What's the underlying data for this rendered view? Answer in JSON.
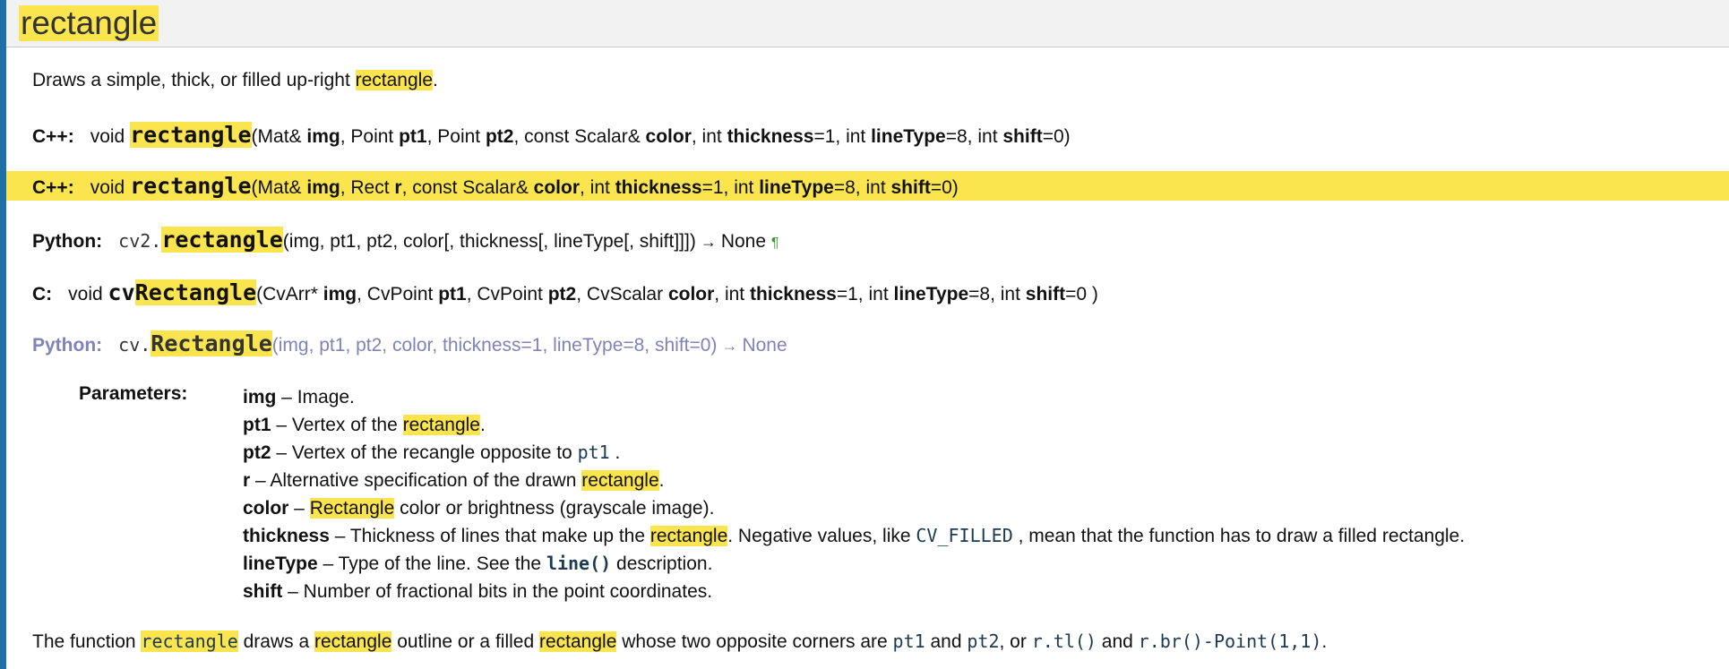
{
  "header": {
    "title": "rectangle"
  },
  "description": {
    "pre": "Draws a simple, thick, or filled up-right ",
    "hl": "rectangle",
    "post": "."
  },
  "signatures": {
    "cpp1": {
      "label": "C++:",
      "ret": "void",
      "fname": "rectangle",
      "open": "(Mat& ",
      "img": "img",
      "s1": ", Point ",
      "pt1": "pt1",
      "s2": ", Point ",
      "pt2": "pt2",
      "s3": ", const Scalar& ",
      "color": "color",
      "s4": ", int ",
      "thickness": "thickness",
      "s5": "=1, int ",
      "lineType": "lineType",
      "s6": "=8, int ",
      "shift": "shift",
      "close": "=0)"
    },
    "cpp2": {
      "label": "C++:",
      "ret": "void",
      "fname": "rectangle",
      "open": "(Mat& ",
      "img": "img",
      "s1": ", Rect ",
      "r": "r",
      "s2": ", const Scalar& ",
      "color": "color",
      "s3": ", int ",
      "thickness": "thickness",
      "s4": "=1, int ",
      "lineType": "lineType",
      "s5": "=8, int ",
      "shift": "shift",
      "close": "=0)"
    },
    "py2": {
      "label": "Python:",
      "module": "cv2.",
      "fname": "rectangle",
      "args": "(img, pt1, pt2, color[, thickness[, lineType[, shift]]])",
      "arrow": " → ",
      "ret": "None",
      "para": "¶"
    },
    "c": {
      "label": "C:",
      "ret": "void",
      "prefix": "cv",
      "fname": "Rectangle",
      "open": "(CvArr* ",
      "img": "img",
      "s1": ", CvPoint ",
      "pt1": "pt1",
      "s2": ", CvPoint ",
      "pt2": "pt2",
      "s3": ", CvScalar ",
      "color": "color",
      "s4": ", int ",
      "thickness": "thickness",
      "s5": "=1, int ",
      "lineType": "lineType",
      "s6": "=8, int ",
      "shift": "shift",
      "close": "=0 )"
    },
    "py1": {
      "label": "Python:",
      "module": "cv.",
      "fname": "Rectangle",
      "args": "(img, pt1, pt2, color, thickness=1, lineType=8, shift=0)",
      "arrow": " → ",
      "ret": "None"
    }
  },
  "parameters": {
    "label": "Parameters:",
    "img": {
      "name": "img",
      "desc": " – Image."
    },
    "pt1": {
      "name": "pt1",
      "desc": " – Vertex of the ",
      "hl": "rectangle",
      "end": "."
    },
    "pt2": {
      "name": "pt2",
      "desc": " – Vertex of the recangle opposite to ",
      "code": "pt1",
      "end": " ."
    },
    "r": {
      "name": "r",
      "desc": " – Alternative specification of the drawn ",
      "hl": "rectangle",
      "end": "."
    },
    "color": {
      "name": "color",
      "dash": " – ",
      "hl": "Rectangle",
      "desc": " color or brightness (grayscale image)."
    },
    "thickness": {
      "name": "thickness",
      "desc": " – Thickness of lines that make up the ",
      "hl": "rectangle",
      "mid": ". Negative values, like ",
      "code": "CV_FILLED",
      "end": " , mean that the function has to draw a filled rectangle."
    },
    "lineType": {
      "name": "lineType",
      "desc": " – Type of the line. See the ",
      "code": "line()",
      "end": " description."
    },
    "shift": {
      "name": "shift",
      "desc": " – Number of fractional bits in the point coordinates."
    }
  },
  "footer": {
    "t1": "The function ",
    "code1": "rectangle",
    "t2": " draws a ",
    "hl1": "rectangle",
    "t3": " outline or a filled ",
    "hl2": "rectangle",
    "t4": " whose two opposite corners are ",
    "c2": "pt1",
    "t5": " and ",
    "c3": "pt2",
    "t6": ", or ",
    "c4": "r.tl()",
    "t7": " and ",
    "c5": "r.br()-Point(1,1)",
    "t8": "."
  },
  "colors": {
    "highlight": "#fbe54e",
    "left_bar": "#1f6fa8",
    "old_python": "#7f83b8"
  }
}
